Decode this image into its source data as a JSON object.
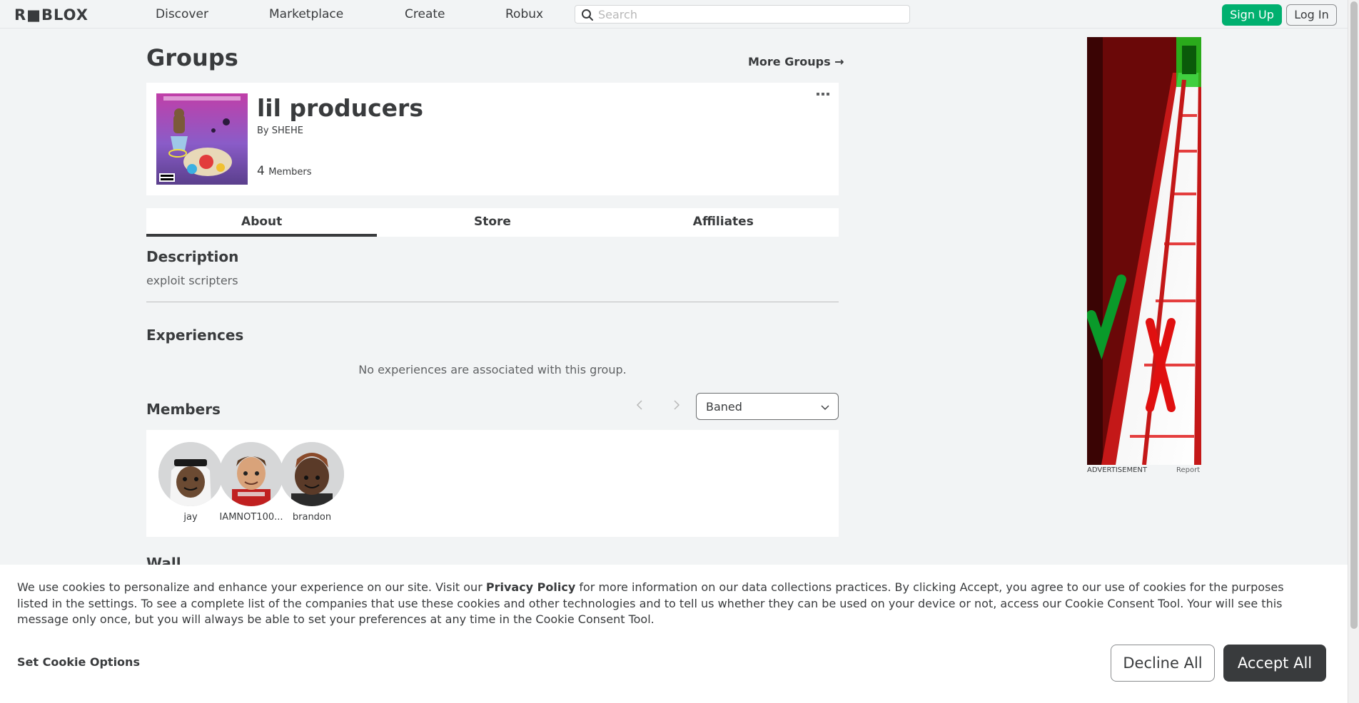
{
  "nav": {
    "logo": "R■BLOX",
    "links": [
      "Discover",
      "Marketplace",
      "Create",
      "Robux"
    ],
    "search_placeholder": "Search",
    "signup": "Sign Up",
    "login": "Log In"
  },
  "page": {
    "title": "Groups",
    "more_groups": "More Groups →"
  },
  "group": {
    "name": "lil producers",
    "by_label": "By",
    "owner": "SHEHE",
    "member_count": "4",
    "members_label": "Members"
  },
  "tabs": [
    {
      "label": "About",
      "active": true
    },
    {
      "label": "Store",
      "active": false
    },
    {
      "label": "Affiliates",
      "active": false
    }
  ],
  "about": {
    "description_heading": "Description",
    "description": "exploit scripters",
    "experiences_heading": "Experiences",
    "no_experiences": "No experiences are associated with this group.",
    "members_heading": "Members",
    "role_selected": "Baned",
    "wall_heading": "Wall"
  },
  "members": [
    {
      "name": "jay"
    },
    {
      "name": "IAMNOT100..."
    },
    {
      "name": "brandon"
    }
  ],
  "ad": {
    "label": "ADVERTISEMENT",
    "report": "Report"
  },
  "cookie": {
    "text_before": "We use cookies to personalize and enhance your experience on our site. Visit our ",
    "link": "Privacy Policy",
    "text_after": " for more information on our data collections practices. By clicking Accept, you agree to our use of cookies for the purposes listed in the settings. To see a complete list of the companies that use these cookies and other technologies and to tell us whether they can be used on your device or not, access our Cookie Consent Tool. Your will see this message only once, but you will always be able to set your preferences at any time in the Cookie Consent Tool.",
    "set_options": "Set Cookie Options",
    "decline": "Decline All",
    "accept": "Accept All"
  },
  "colors": {
    "accent_green": "#00b06f",
    "text": "#393b3d",
    "background": "#f2f4f5"
  }
}
